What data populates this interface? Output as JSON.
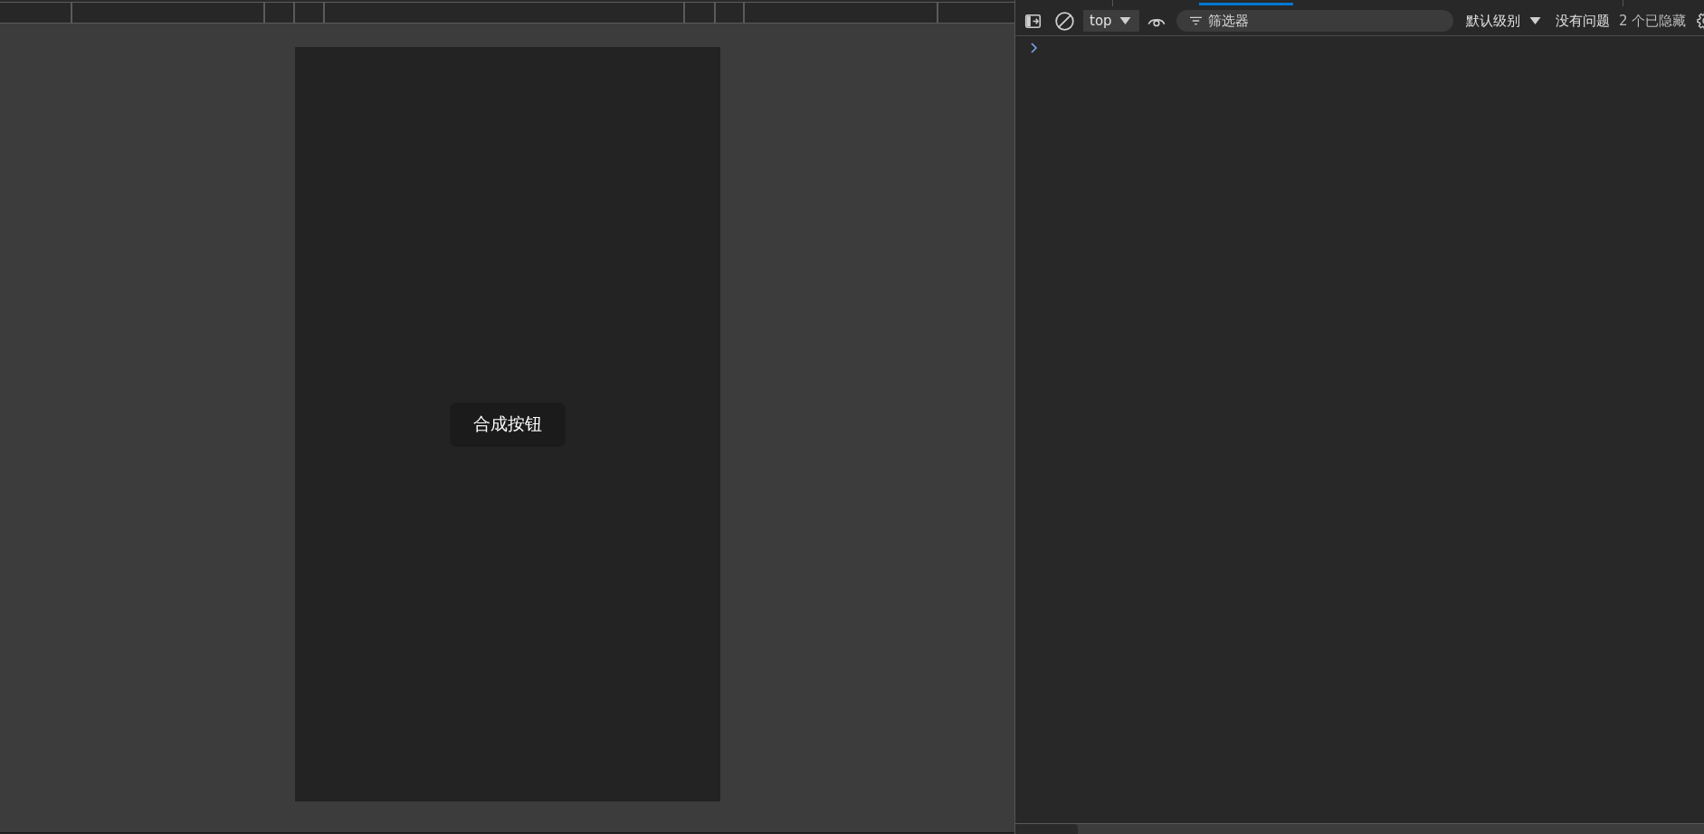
{
  "viewport": {
    "button": {
      "label": "合成按钮"
    }
  },
  "devtools": {
    "tabs": [
      {
        "selected": true
      }
    ],
    "toolbar": {
      "context": "top",
      "filter": {
        "placeholder": "筛选器"
      },
      "log_level": "默认级别",
      "issues": "没有问题",
      "hidden_count": "2 个已隐藏"
    },
    "drawer": {
      "tabs": [
        {
          "selected": true
        }
      ]
    }
  }
}
